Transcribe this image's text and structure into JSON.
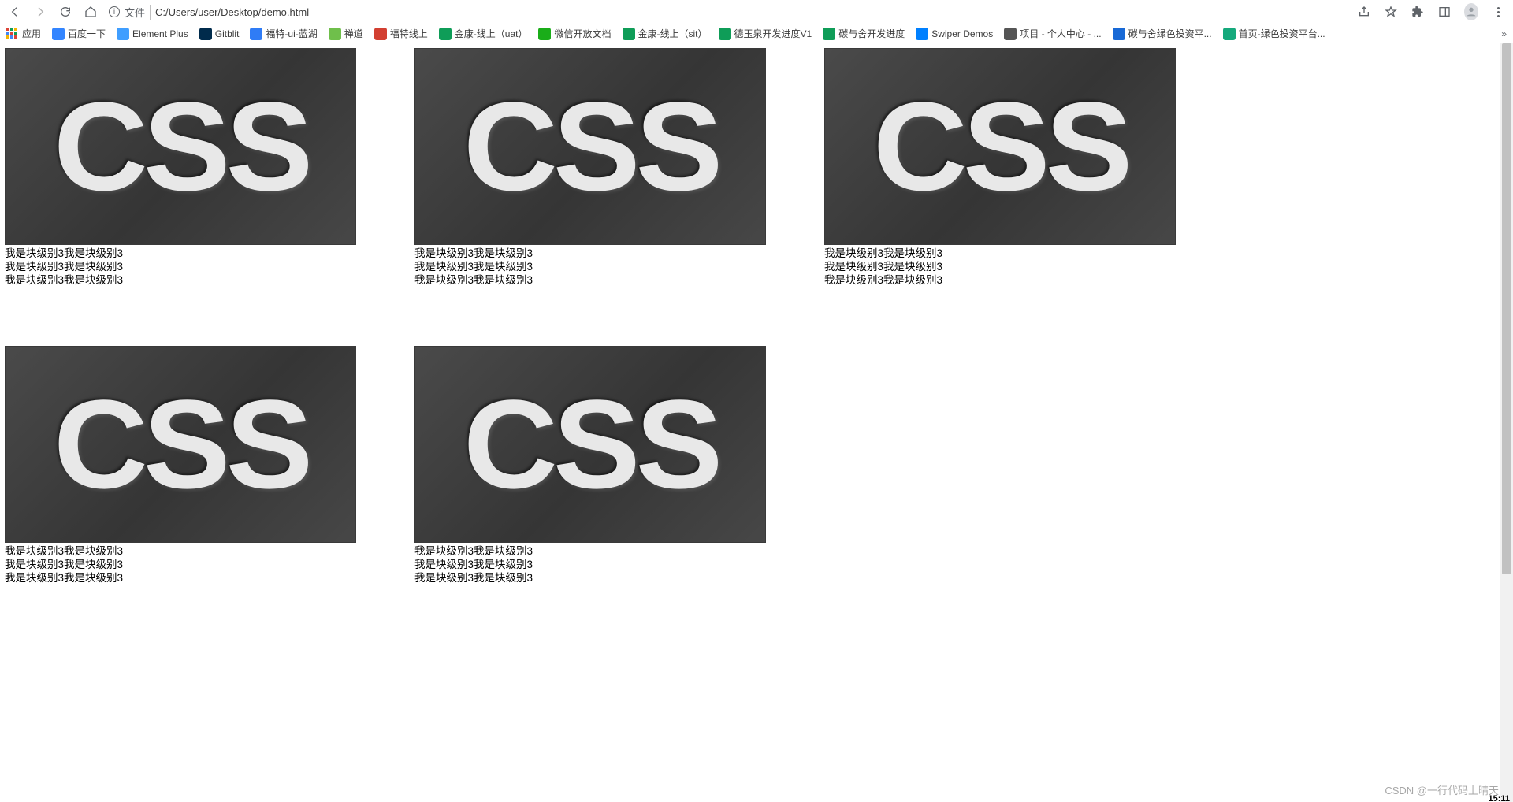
{
  "browser": {
    "address": {
      "file_label": "文件",
      "path": "C:/Users/user/Desktop/demo.html"
    },
    "bookmarks": [
      {
        "label": "应用",
        "color": "apps"
      },
      {
        "label": "百度一下",
        "color": "#3385ff"
      },
      {
        "label": "Element Plus",
        "color": "#409eff"
      },
      {
        "label": "Gitblit",
        "color": "#002b4c"
      },
      {
        "label": "福特-ui-蓝湖",
        "color": "#2f7cf6"
      },
      {
        "label": "禅道",
        "color": "#6fbf4b"
      },
      {
        "label": "福特线上",
        "color": "#d23f31"
      },
      {
        "label": "金康-线上（uat）",
        "color": "#0f9d58"
      },
      {
        "label": "微信开放文档",
        "color": "#1aad19"
      },
      {
        "label": "金康-线上（sit）",
        "color": "#0f9d58"
      },
      {
        "label": "德玉泉开发进度V1",
        "color": "#0f9d58"
      },
      {
        "label": "碳与舍开发进度",
        "color": "#0f9d58"
      },
      {
        "label": "Swiper Demos",
        "color": "#0080ff"
      },
      {
        "label": "项目 - 个人中心 - ...",
        "color": "#555555"
      },
      {
        "label": "碳与舍绿色投资平...",
        "color": "#1869d6"
      },
      {
        "label": "首页-绿色投资平台...",
        "color": "#15a97c"
      }
    ]
  },
  "page": {
    "image_text": "CSS",
    "caption_line": "我是块级别3我是块级别3",
    "lines_per_card": 3,
    "card_count": 5
  },
  "watermark": "CSDN @一行代码上晴天",
  "clock": "15:11"
}
